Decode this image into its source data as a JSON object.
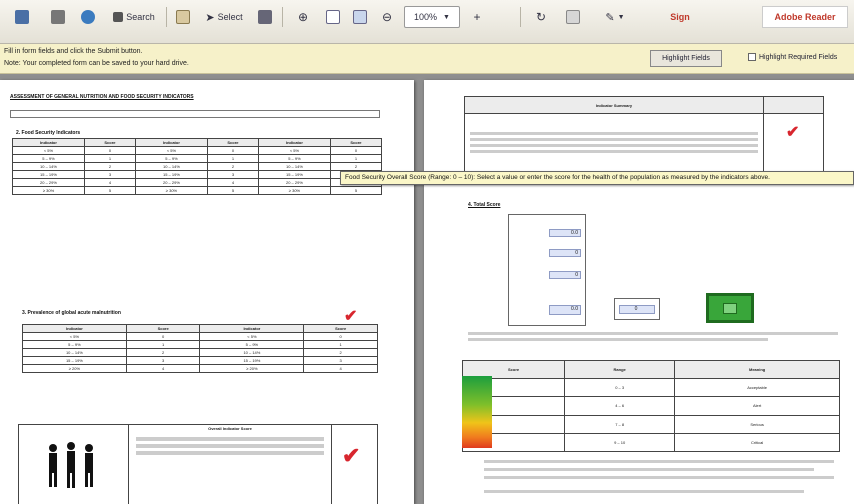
{
  "toolbar": {
    "search_label": "Search",
    "select_label": "Select",
    "zoom_value": "100%",
    "sign_label": "Sign",
    "brand": "Adobe Reader"
  },
  "form_bar": {
    "line1": "Fill in form fields and click the Submit button.",
    "line2": "Note: Your completed form can be saved to your hard drive.",
    "highlight_button": "Highlight Fields",
    "highlight_required": "Highlight Required Fields"
  },
  "tooltip": {
    "text": "Food Security Overall Score (Range: 0 – 10): Select a value or enter the score for the health of the population as measured by the indicators above."
  },
  "left_page": {
    "title": "ASSESSMENT OF GENERAL NUTRITION AND FOOD SECURITY INDICATORS",
    "section2_heading": "2. Food Security Indicators",
    "table1_headers": [
      "Indicator",
      "Score",
      "Indicator",
      "Score",
      "Indicator",
      "Score"
    ],
    "table1_rows": [
      [
        "< 5%",
        "0",
        "< 5%",
        "0",
        "< 5%",
        "0"
      ],
      [
        "5 – 9%",
        "1",
        "5 – 9%",
        "1",
        "5 – 9%",
        "1"
      ],
      [
        "10 – 14%",
        "2",
        "10 – 14%",
        "2",
        "10 – 14%",
        "2"
      ],
      [
        "15 – 19%",
        "3",
        "15 – 19%",
        "3",
        "15 – 19%",
        "3"
      ],
      [
        "20 – 29%",
        "4",
        "20 – 29%",
        "4",
        "20 – 29%",
        "4"
      ],
      [
        "≥ 30%",
        "5",
        "≥ 30%",
        "5",
        "≥ 30%",
        "5"
      ]
    ],
    "section3_heading": "3. Prevalence of global acute malnutrition",
    "table2_headers": [
      "Indicator",
      "Score",
      "Indicator",
      "Score"
    ],
    "table2_rows": [
      [
        "< 5%",
        "0",
        "< 5%",
        "0"
      ],
      [
        "5 – 9%",
        "1",
        "5 – 9%",
        "1"
      ],
      [
        "10 – 14%",
        "2",
        "10 – 14%",
        "2"
      ],
      [
        "15 – 19%",
        "3",
        "15 – 19%",
        "3"
      ],
      [
        "≥ 20%",
        "4",
        "≥ 20%",
        "4"
      ]
    ],
    "table3_header": "Overall Indicator Score",
    "check_glyph": "✔"
  },
  "right_page": {
    "box_header": "Indicator Summary",
    "check_glyph": "✔",
    "section_heading": "4. Total Score",
    "calc_values": [
      "0.0",
      "0",
      "0",
      "0.0",
      "0"
    ],
    "scale_headers": [
      "Score",
      "Range",
      "Meaning"
    ],
    "scale_rows": [
      [
        "0 – 3",
        "Acceptable"
      ],
      [
        "4 – 6",
        "Alert"
      ],
      [
        "7 – 8",
        "Serious"
      ],
      [
        "9 – 10",
        "Critical"
      ]
    ]
  }
}
